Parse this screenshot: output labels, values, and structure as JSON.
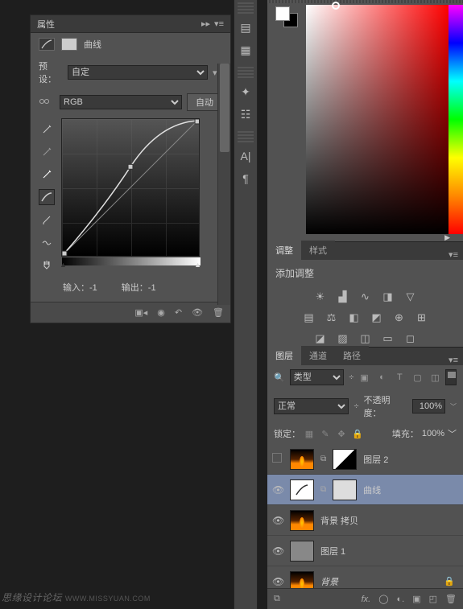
{
  "properties": {
    "title": "属性",
    "adjustment_name": "曲线",
    "preset_label": "预设：",
    "preset_value": "自定",
    "channel_value": "RGB",
    "auto_label": "自动",
    "input_label": "输入：",
    "input_value": "-1",
    "output_label": "输出：",
    "output_value": "-1"
  },
  "color": {
    "fg": "#ffffff",
    "bg": "#000000"
  },
  "adjustments": {
    "tab_adjust": "调整",
    "tab_style": "样式",
    "title": "添加调整"
  },
  "layers": {
    "tab_layers": "图层",
    "tab_channels": "通道",
    "tab_paths": "路径",
    "filter_kind": "类型",
    "blend_mode": "正常",
    "opacity_label": "不透明度：",
    "opacity_value": "100%",
    "lock_label": "锁定：",
    "fill_label": "填充：",
    "fill_value": "100%",
    "items": [
      {
        "name": "图层 2",
        "visible": false,
        "selected": false,
        "thumb": "fire",
        "mask": true
      },
      {
        "name": "曲线",
        "visible": true,
        "selected": true,
        "thumb": "adj",
        "mask": true,
        "adj": true
      },
      {
        "name": "背景 拷贝",
        "visible": true,
        "selected": false,
        "thumb": "fire"
      },
      {
        "name": "图层 1",
        "visible": true,
        "selected": false,
        "thumb": "smart"
      },
      {
        "name": "背景",
        "visible": true,
        "selected": false,
        "thumb": "fire",
        "locked": true,
        "italic": true
      }
    ]
  },
  "watermark": {
    "text": "思缘设计论坛",
    "url": "WWW.MISSYUAN.COM"
  },
  "chart_data": {
    "type": "line",
    "title": "曲线",
    "channel": "RGB",
    "x": [
      0,
      64,
      128,
      193,
      255
    ],
    "y": [
      0,
      100,
      165,
      224,
      255
    ],
    "xlim": [
      0,
      255
    ],
    "ylim": [
      0,
      255
    ],
    "input": -1,
    "output": -1,
    "xlabel": "输入",
    "ylabel": "输出"
  }
}
